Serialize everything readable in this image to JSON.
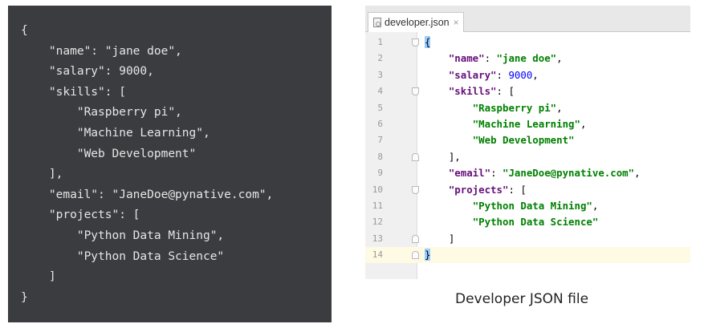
{
  "dark_panel": {
    "lines": [
      "{",
      "    \"name\": \"jane doe\",",
      "    \"salary\": 9000,",
      "    \"skills\": [",
      "        \"Raspberry pi\",",
      "        \"Machine Learning\",",
      "        \"Web Development\"",
      "    ],",
      "    \"email\": \"JaneDoe@pynative.com\",",
      "    \"projects\": [",
      "        \"Python Data Mining\",",
      "        \"Python Data Science\"",
      "    ]",
      "}"
    ]
  },
  "ide": {
    "tab": {
      "filename": "developer.json",
      "close_glyph": "×"
    },
    "lines": [
      {
        "num": "1",
        "fold": "start",
        "indent": "",
        "parts": [
          {
            "t": "{",
            "c": "p",
            "hl": true
          }
        ]
      },
      {
        "num": "2",
        "fold": "",
        "indent": "    ",
        "parts": [
          {
            "t": "\"name\"",
            "c": "k"
          },
          {
            "t": ": ",
            "c": "p"
          },
          {
            "t": "\"jane doe\"",
            "c": "s"
          },
          {
            "t": ",",
            "c": "p"
          }
        ]
      },
      {
        "num": "3",
        "fold": "",
        "indent": "    ",
        "parts": [
          {
            "t": "\"salary\"",
            "c": "k"
          },
          {
            "t": ": ",
            "c": "p"
          },
          {
            "t": "9000",
            "c": "n"
          },
          {
            "t": ",",
            "c": "p"
          }
        ]
      },
      {
        "num": "4",
        "fold": "start",
        "indent": "    ",
        "parts": [
          {
            "t": "\"skills\"",
            "c": "k"
          },
          {
            "t": ": [",
            "c": "p"
          }
        ]
      },
      {
        "num": "5",
        "fold": "",
        "indent": "        ",
        "parts": [
          {
            "t": "\"Raspberry pi\"",
            "c": "s"
          },
          {
            "t": ",",
            "c": "p"
          }
        ]
      },
      {
        "num": "6",
        "fold": "",
        "indent": "        ",
        "parts": [
          {
            "t": "\"Machine Learning\"",
            "c": "s"
          },
          {
            "t": ",",
            "c": "p"
          }
        ]
      },
      {
        "num": "7",
        "fold": "",
        "indent": "        ",
        "parts": [
          {
            "t": "\"Web Development\"",
            "c": "s"
          }
        ]
      },
      {
        "num": "8",
        "fold": "end",
        "indent": "    ",
        "parts": [
          {
            "t": "],",
            "c": "p"
          }
        ]
      },
      {
        "num": "9",
        "fold": "",
        "indent": "    ",
        "parts": [
          {
            "t": "\"email\"",
            "c": "k"
          },
          {
            "t": ": ",
            "c": "p"
          },
          {
            "t": "\"JaneDoe@pynative.com\"",
            "c": "s"
          },
          {
            "t": ",",
            "c": "p"
          }
        ]
      },
      {
        "num": "10",
        "fold": "start",
        "indent": "    ",
        "parts": [
          {
            "t": "\"projects\"",
            "c": "k"
          },
          {
            "t": ": [",
            "c": "p"
          }
        ]
      },
      {
        "num": "11",
        "fold": "",
        "indent": "        ",
        "parts": [
          {
            "t": "\"Python Data Mining\"",
            "c": "s"
          },
          {
            "t": ",",
            "c": "p"
          }
        ]
      },
      {
        "num": "12",
        "fold": "",
        "indent": "        ",
        "parts": [
          {
            "t": "\"Python Data Science\"",
            "c": "s"
          }
        ]
      },
      {
        "num": "13",
        "fold": "end",
        "indent": "    ",
        "parts": [
          {
            "t": "]",
            "c": "p"
          }
        ]
      },
      {
        "num": "14",
        "fold": "end",
        "indent": "",
        "current": true,
        "parts": [
          {
            "t": "}",
            "c": "p",
            "hl": true
          }
        ]
      }
    ]
  },
  "caption": "Developer JSON file",
  "colors": {
    "dark_bg": "#3a3c3f",
    "key": "#660e7a",
    "string": "#008000",
    "number": "#0000ff",
    "current_line": "#fffae3",
    "brace_highlight": "#99ccff"
  }
}
